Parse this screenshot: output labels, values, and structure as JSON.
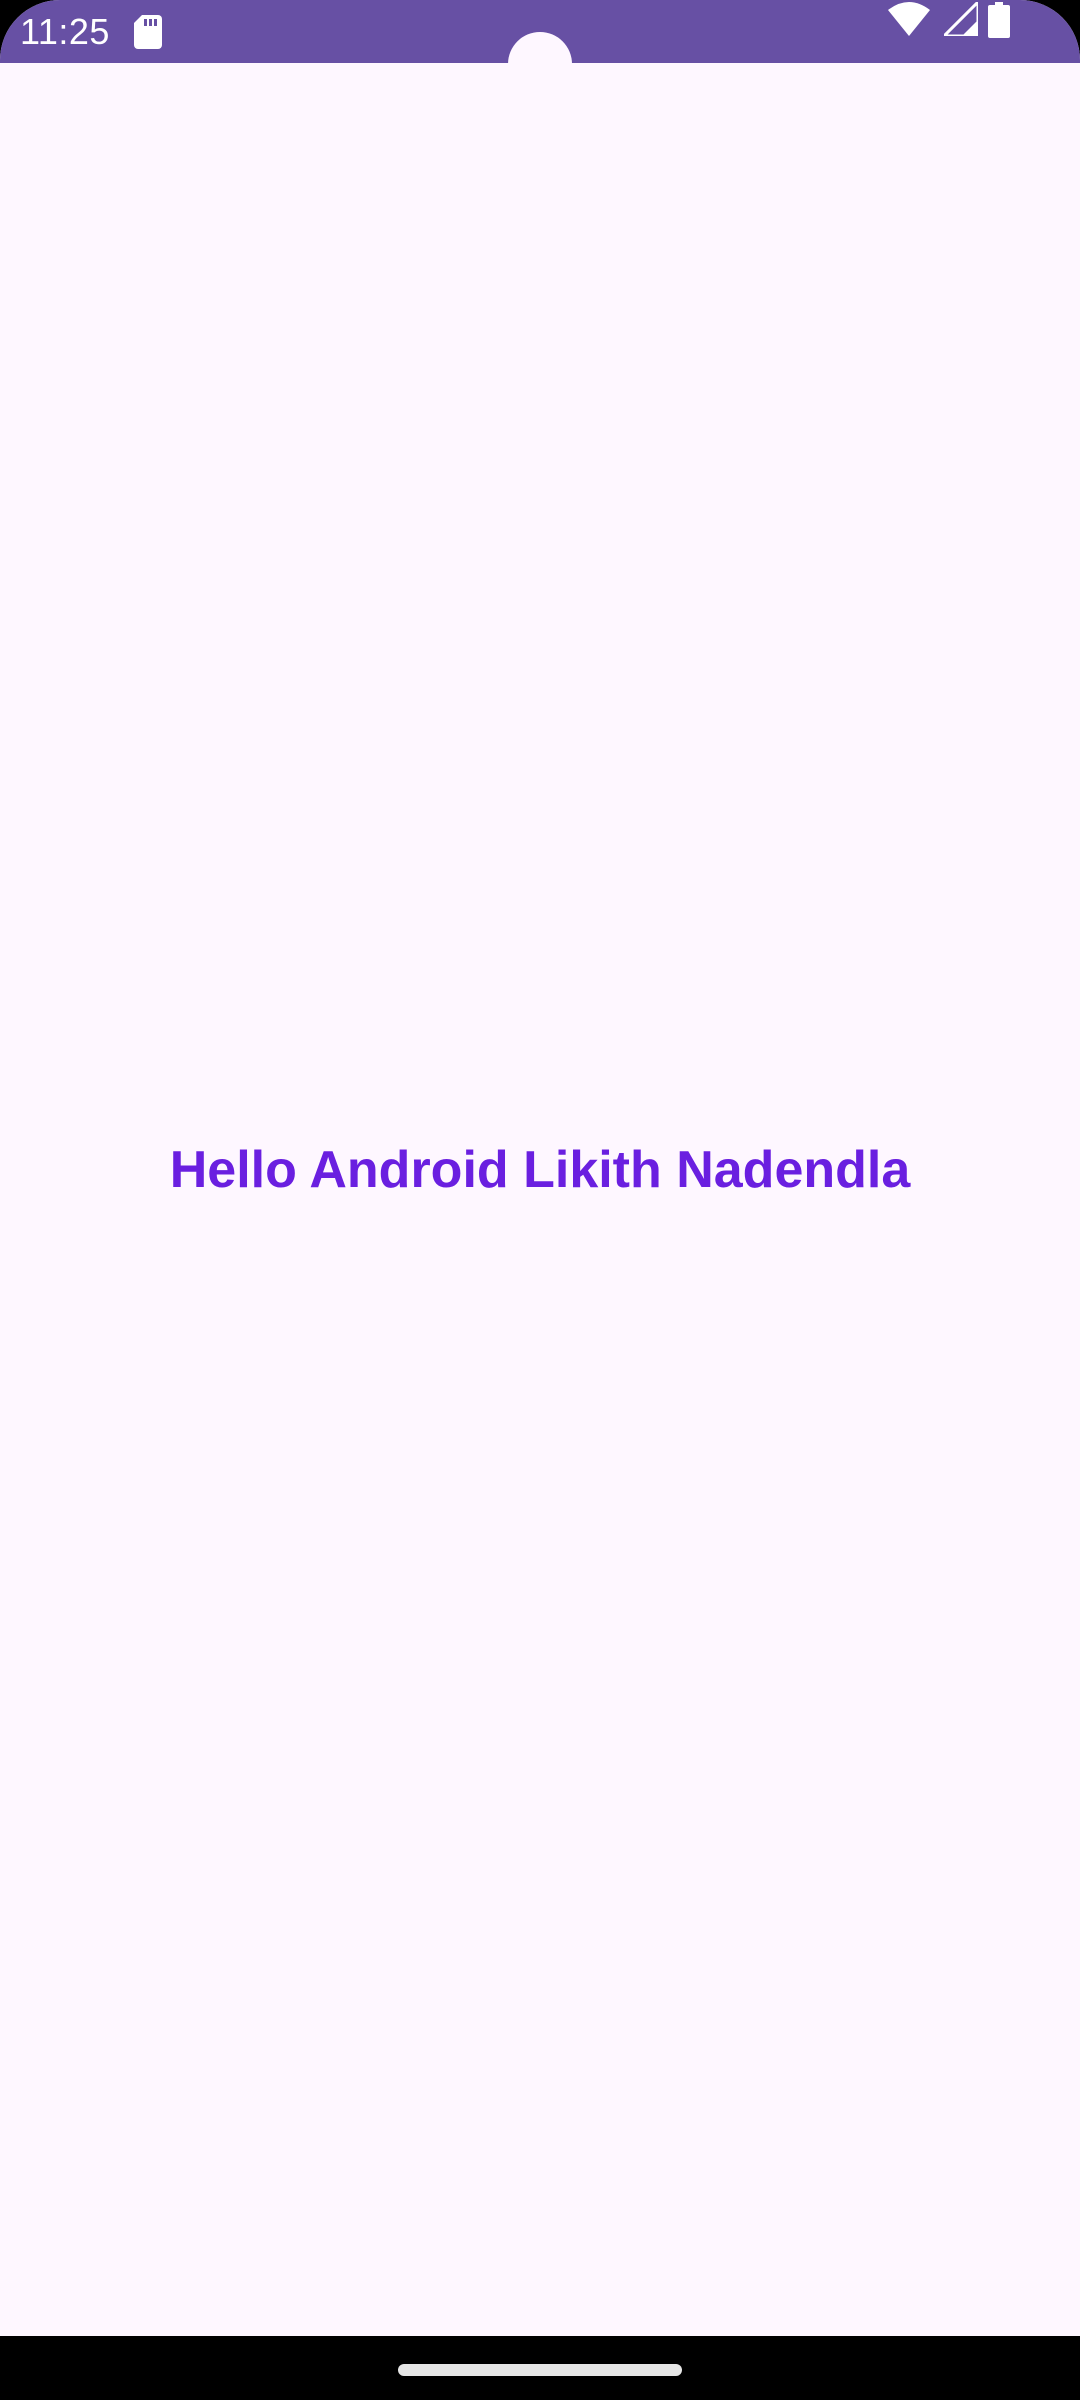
{
  "status_bar": {
    "time": "11:25",
    "icons": [
      "sd-card-icon",
      "wifi-icon",
      "cell-signal-icon",
      "battery-icon"
    ],
    "background_color": "#6750A4"
  },
  "main": {
    "greeting": "Hello Android Likith Nadendla",
    "text_color": "#6A1FE0",
    "background_color": "#FEF7FF"
  },
  "nav_bar": {
    "type": "gesture-navigation"
  }
}
